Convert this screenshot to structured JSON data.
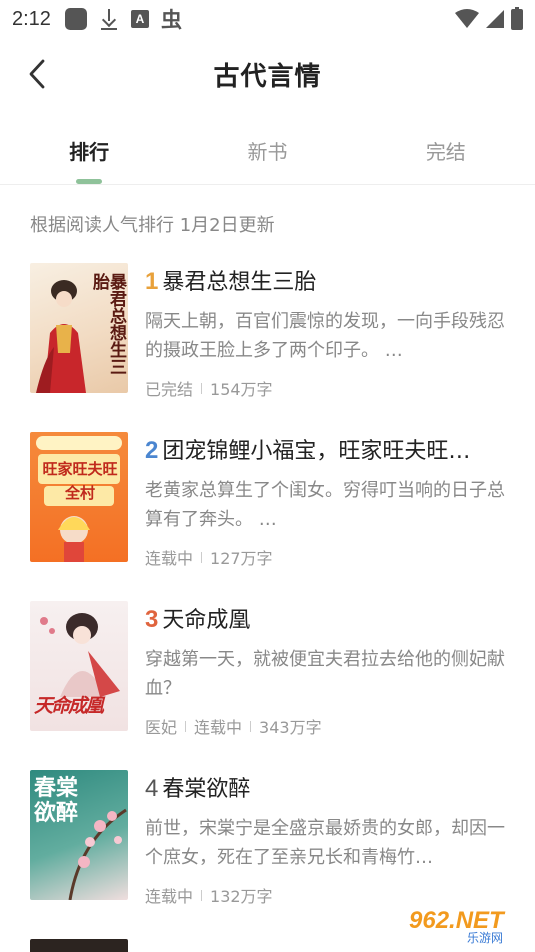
{
  "status_bar": {
    "time": "2:12",
    "left_icons": [
      "app-square-icon",
      "download-icon",
      "a-badge-icon",
      "bug-icon"
    ],
    "right_icons": [
      "wifi-icon",
      "signal-icon",
      "battery-icon"
    ]
  },
  "header": {
    "title": "古代言情",
    "back_icon": "chevron-left-icon"
  },
  "tabs": [
    {
      "label": "排行",
      "active": true
    },
    {
      "label": "新书",
      "active": false
    },
    {
      "label": "完结",
      "active": false
    }
  ],
  "update_note": "根据阅读人气排行 1月2日更新",
  "books": [
    {
      "rank": "1",
      "title": "暴君总想生三胎",
      "description": "隔天上朝，百官们震惊的发现，一向手段残忍的摄政王脸上多了两个印子。 …",
      "tags": [
        "已完结",
        "154万字"
      ],
      "cover_text": "暴君总想生三胎",
      "cover_colors": [
        "#f6e9d6",
        "#c92a2a"
      ]
    },
    {
      "rank": "2",
      "title": "团宠锦鲤小福宝，旺家旺夫旺…",
      "description": "老黄家总算生了个闺女。穷得叮当响的日子总算有了奔头。 …",
      "tags": [
        "连载中",
        "127万字"
      ],
      "cover_text": "旺家旺夫旺全村",
      "cover_colors": [
        "#f47b2a",
        "#fff3c4"
      ]
    },
    {
      "rank": "3",
      "title": "天命成凰",
      "description": "穿越第一天，就被便宜夫君拉去给他的侧妃献血？",
      "tags": [
        "医妃",
        "连载中",
        "343万字"
      ],
      "cover_text": "天命成凰",
      "cover_colors": [
        "#f4ecec",
        "#c62828"
      ]
    },
    {
      "rank": "4",
      "title": "春棠欲醉",
      "description": "前世，宋棠宁是全盛京最娇贵的女郎，却因一个庶女，死在了至亲兄长和青梅竹…",
      "tags": [
        "连载中",
        "132万字"
      ],
      "cover_text": "春棠欲醉",
      "cover_colors": [
        "#3a8f86",
        "#f3e4e4"
      ]
    }
  ],
  "watermark": {
    "main": "962.NET",
    "sub": "乐游网"
  }
}
